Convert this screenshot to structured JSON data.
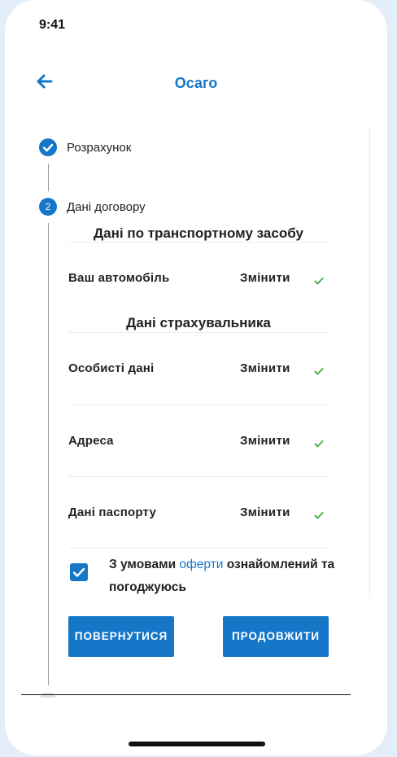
{
  "status_bar": {
    "time": "9:41"
  },
  "header": {
    "title": "Осаго",
    "back_icon": "arrow-left-icon"
  },
  "steps": [
    {
      "label": "Розрахунок",
      "state": "completed",
      "icon": "check-circle-icon"
    },
    {
      "number": "2",
      "label": "Дані договору",
      "state": "active"
    }
  ],
  "vehicle_section": {
    "heading": "Дані по транспортному засобу",
    "rows": [
      {
        "label": "Ваш автомобіль",
        "action": "Змінити",
        "status_icon": "check-icon"
      }
    ]
  },
  "insurer_section": {
    "heading": "Дані страхувальника",
    "rows": [
      {
        "label": "Особисті дані",
        "action": "Змінити",
        "status_icon": "check-icon"
      },
      {
        "label": "Адреса",
        "action": "Змінити",
        "status_icon": "check-icon"
      },
      {
        "label": "Дані паспорту",
        "action": "Змінити",
        "status_icon": "check-icon"
      }
    ]
  },
  "consent": {
    "checked": true,
    "prefix": "З умовами",
    "link": "оферти",
    "suffix": "ознайомлений та погоджуюсь"
  },
  "buttons": {
    "back": "ПОВЕРНУТИСЯ",
    "next": "ПРОДОВЖИТИ"
  },
  "colors": {
    "accent": "#1677c9",
    "check": "#4caf50",
    "text": "#222222",
    "background": "#e3eef9"
  }
}
